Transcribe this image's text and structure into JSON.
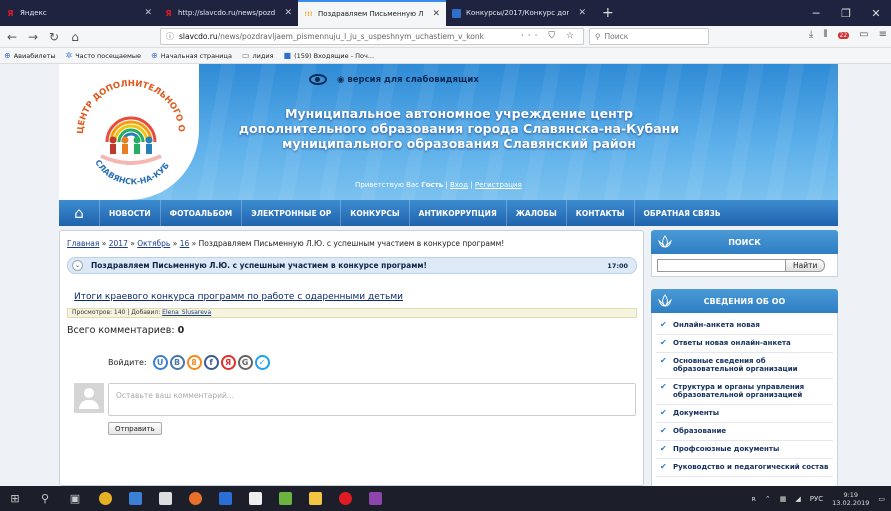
{
  "browser": {
    "tabs": [
      {
        "title": "Яндекс",
        "favicon_letter": "Я",
        "favicon_color": "#e01b22",
        "active": false
      },
      {
        "title": "http://slavcdo.ru/news/pozdra",
        "favicon_letter": "Я",
        "favicon_color": "#e01b22",
        "active": false
      },
      {
        "title": "Поздравляем Письменную Л.",
        "favicon_letter": "!!!",
        "favicon_color": "#f5a623",
        "active": true
      },
      {
        "title": "Конкурсы/2017/Конкурс доп",
        "favicon_letter": "■",
        "favicon_color": "#2f6ec9",
        "active": false
      }
    ],
    "new_tab": "+",
    "window_controls": {
      "minimize": "─",
      "restore": "❐",
      "close": "✕"
    },
    "url_host": "slavcdo.ru",
    "url_path": "/news/pozdravljaem_pismennuju_l_ju_s_uspeshnym_uchastiem_v_konk",
    "url_actions": "··· ⛉ ☆",
    "search_placeholder": "Поиск",
    "toolbar_badge": "22",
    "bookmarks": [
      {
        "label": "Авиабилеты",
        "icon": "globe-icon"
      },
      {
        "label": "Часто посещаемые",
        "icon": "gear-icon"
      },
      {
        "label": "Начальная страница",
        "icon": "globe-icon"
      },
      {
        "label": "лидия",
        "icon": "folder-icon"
      },
      {
        "label": "(159) Входящие - Поч...",
        "icon": "mail-icon"
      }
    ]
  },
  "header": {
    "vision_label": "версия для слабовидящих",
    "title_lines": [
      "Муниципальное автономное учреждение центр",
      "дополнительного образования города Славянска-на-Кубани",
      "муниципального образования Славянский район"
    ],
    "greeting_prefix": "Приветствую Вас",
    "greeting_user": "Гость",
    "login_link": "Вход",
    "register_link": "Регистрация",
    "logo_top_text": "ЦЕНТР ДОПОЛНИТЕЛЬНОГО ОБРАЗОВАНИЯ",
    "logo_bottom_text": "СЛАВЯНСК-НА-КУБАНИ"
  },
  "menu": {
    "items": [
      "НОВОСТИ",
      "ФОТОАЛЬБОМ",
      "ЭЛЕКТРОННЫЕ ОР",
      "КОНКУРСЫ",
      "АНТИКОРРУПЦИЯ",
      "ЖАЛОБЫ",
      "КОНТАКТЫ",
      "ОБРАТНАЯ СВЯЗЬ"
    ]
  },
  "content": {
    "crumbs": {
      "home": "Главная",
      "year": "2017",
      "month": "Октябрь",
      "day": "16",
      "current": "Поздравляем Письменную Л.Ю. с успешным участием в конкурсе программ!"
    },
    "news_title": "Поздравляем Письменную Л.Ю. с успешным участием в конкурсе программ!",
    "news_time": "17:00",
    "article_link": "Итоги краевого конкурса программ по работе с одаренными детьми",
    "views_label": "Просмотров: 140 | Добавил:",
    "author": "Elena_Slusareva",
    "comments_label": "Всего комментариев:",
    "comments_count": "0",
    "login_label": "Войдите:",
    "social": [
      {
        "letter": "U",
        "color": "#3b7fd6",
        "name": "ucoz-login-icon"
      },
      {
        "letter": "B",
        "color": "#4a76a8",
        "name": "vk-login-icon"
      },
      {
        "letter": "8",
        "color": "#f28a1d",
        "name": "odnoklassniki-login-icon"
      },
      {
        "letter": "f",
        "color": "#3b5998",
        "name": "facebook-login-icon"
      },
      {
        "letter": "Я",
        "color": "#e0312d",
        "name": "yandex-login-icon"
      },
      {
        "letter": "G",
        "color": "#666666",
        "name": "google-login-icon"
      },
      {
        "letter": "✓",
        "color": "#1da1f2",
        "name": "twitter-login-icon"
      }
    ],
    "comment_placeholder": "Оставьте ваш комментарий...",
    "submit_label": "Отправить"
  },
  "sidebar": {
    "search_title": "ПОИСК",
    "search_button": "Найти",
    "info_title": "СВЕДЕНИЯ ОБ ОО",
    "items": [
      "Онлайн-анкета новая",
      "Ответы новая онлайн-анкета",
      "Основные сведения об образовательной организации",
      "Структура и органы управления образовательной организацией",
      "Документы",
      "Образование",
      "Профсоюзные документы",
      "Руководство и педагогический состав"
    ]
  },
  "taskbar": {
    "lang": "РУС",
    "time": "9:19",
    "date": "13.02.2019"
  },
  "colors": {
    "menu_blue": "#1f63ad",
    "header_blue": "#2f8bd6",
    "link_blue": "#1a3f8a",
    "check_blue": "#2f7ec4"
  }
}
